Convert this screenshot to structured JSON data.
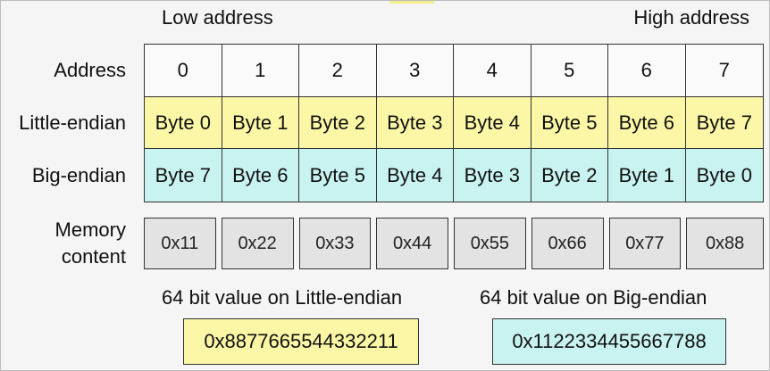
{
  "headers": {
    "low": "Low address",
    "high": "High address"
  },
  "rows": {
    "address": {
      "label": "Address",
      "cells": [
        "0",
        "1",
        "2",
        "3",
        "4",
        "5",
        "6",
        "7"
      ]
    },
    "little_endian": {
      "label": "Little-endian",
      "cells": [
        "Byte 0",
        "Byte 1",
        "Byte 2",
        "Byte 3",
        "Byte 4",
        "Byte 5",
        "Byte 6",
        "Byte 7"
      ]
    },
    "big_endian": {
      "label": "Big-endian",
      "cells": [
        "Byte 7",
        "Byte 6",
        "Byte 5",
        "Byte 4",
        "Byte 3",
        "Byte 2",
        "Byte 1",
        "Byte 0"
      ]
    }
  },
  "memory": {
    "label_line1": "Memory",
    "label_line2": "content",
    "cells": [
      "0x11",
      "0x22",
      "0x33",
      "0x44",
      "0x55",
      "0x66",
      "0x77",
      "0x88"
    ]
  },
  "values": {
    "little_caption": "64 bit value on Little-endian",
    "little_value": "0x8877665544332211",
    "big_caption": "64 bit value on Big-endian",
    "big_value": "0x1122334455667788"
  },
  "colors": {
    "little_endian": "#fbf7a6",
    "big_endian": "#c9f3f1",
    "memory": "#e3e3e3"
  }
}
